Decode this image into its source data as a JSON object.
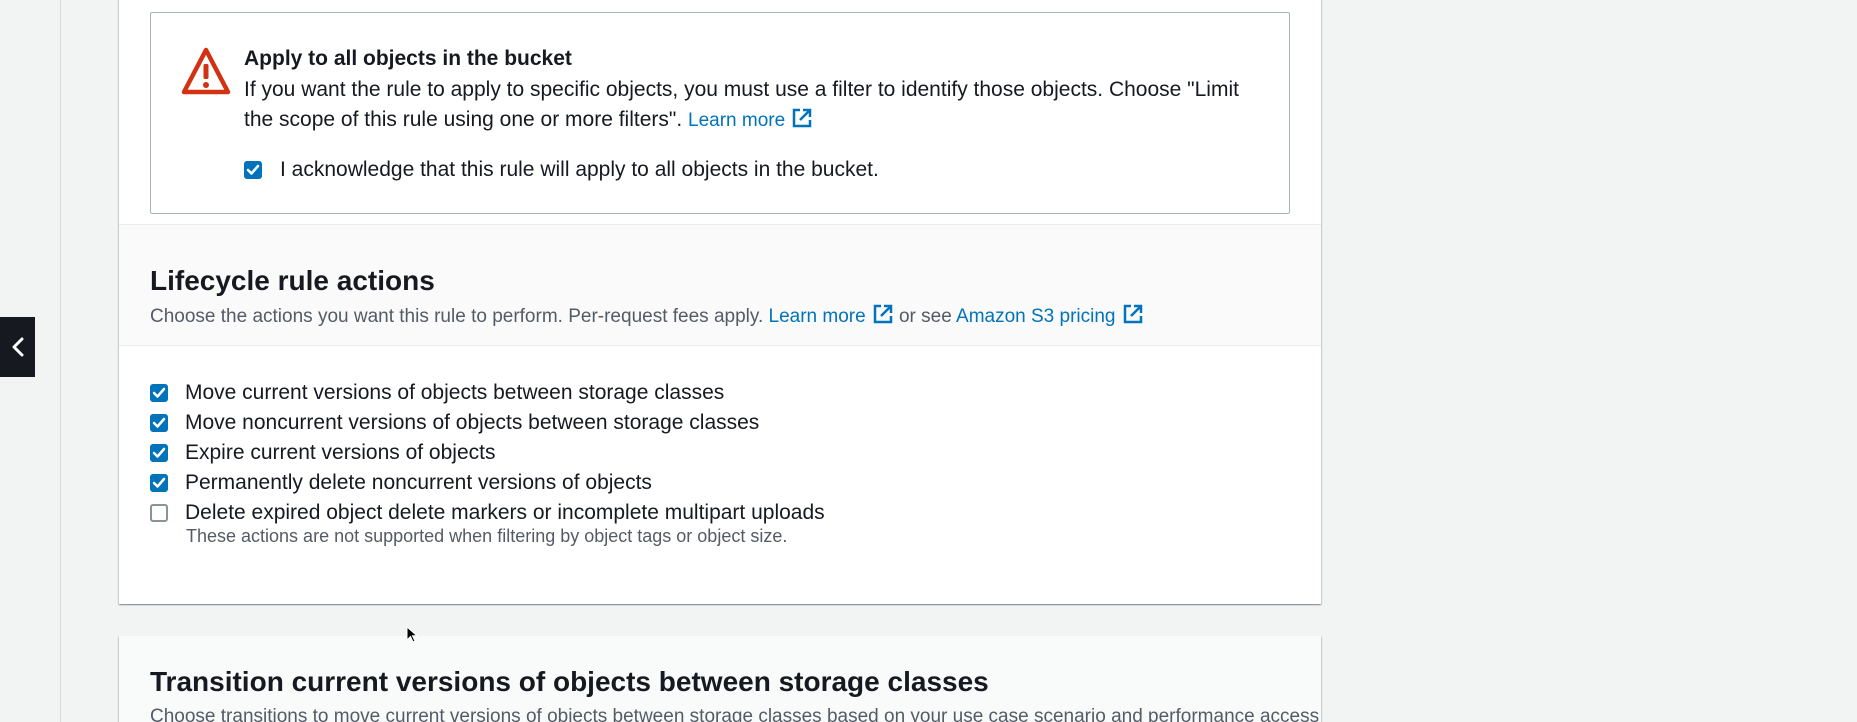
{
  "alert": {
    "title": "Apply to all objects in the bucket",
    "body": "If you want the rule to apply to specific objects, you must use a filter to identify those objects. Choose \"Limit the scope of this rule using one or more filters\".",
    "learn_more": "Learn more",
    "acknowledge_label": "I acknowledge that this rule will apply to all objects in the bucket.",
    "acknowledge_checked": true
  },
  "lifecycle": {
    "title": "Lifecycle rule actions",
    "desc_prefix": "Choose the actions you want this rule to perform. Per-request fees apply.",
    "learn_more": "Learn more",
    "or_see": "or see",
    "pricing_link": "Amazon S3 pricing",
    "actions": [
      {
        "label": "Move current versions of objects between storage classes",
        "checked": true
      },
      {
        "label": "Move noncurrent versions of objects between storage classes",
        "checked": true
      },
      {
        "label": "Expire current versions of objects",
        "checked": true
      },
      {
        "label": "Permanently delete noncurrent versions of objects",
        "checked": true
      },
      {
        "label": "Delete expired object delete markers or incomplete multipart uploads",
        "checked": false
      }
    ],
    "note": "These actions are not supported when filtering by object tags or object size."
  },
  "transition": {
    "title": "Transition current versions of objects between storage classes",
    "desc": "Choose transitions to move current versions of objects between storage classes based on your use case scenario and performance access"
  },
  "colors": {
    "link": "#0073bb",
    "warning": "#d13212",
    "checkbox": "#0073bb"
  },
  "icons": {
    "warning": "warning-triangle-icon",
    "external": "external-link-icon",
    "chevron": "chevron-left-icon"
  }
}
